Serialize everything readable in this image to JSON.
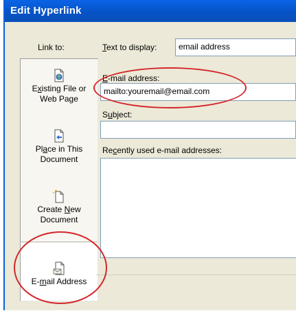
{
  "dialog": {
    "title": "Edit Hyperlink"
  },
  "sidebar": {
    "link_to_label": "Link to:",
    "items": [
      {
        "label_line1_pre": "E",
        "label_line1_u": "x",
        "label_line1_post": "isting File or",
        "label_line2": "Web Page",
        "icon": "file-web-page-icon",
        "selected": false
      },
      {
        "label_line1_pre": "Pl",
        "label_line1_u": "a",
        "label_line1_post": "ce in This",
        "label_line2": "Document",
        "icon": "place-in-document-icon",
        "selected": false
      },
      {
        "label_line1_pre": "Create ",
        "label_line1_u": "N",
        "label_line1_post": "ew",
        "label_line2": "Document",
        "icon": "new-document-icon",
        "selected": false
      },
      {
        "label_line1_pre": "E-",
        "label_line1_u": "m",
        "label_line1_post": "ail Address",
        "label_line2": "",
        "icon": "email-address-icon",
        "selected": true
      }
    ]
  },
  "form": {
    "text_to_display_label_u": "T",
    "text_to_display_label_rest": "ext to display:",
    "text_to_display_value": "email address",
    "email_label_u": "E",
    "email_label_rest": "-mail address:",
    "email_value": "mailto:youremail@email.com",
    "subject_label_pre": "S",
    "subject_label_u": "u",
    "subject_label_rest": "bject:",
    "subject_value": "",
    "recent_label_pre": "Re",
    "recent_label_u": "c",
    "recent_label_rest": "ently used e-mail addresses:",
    "recent_items": []
  },
  "annotation_color": "#d4262c",
  "title_bar_color": "#0653c7"
}
